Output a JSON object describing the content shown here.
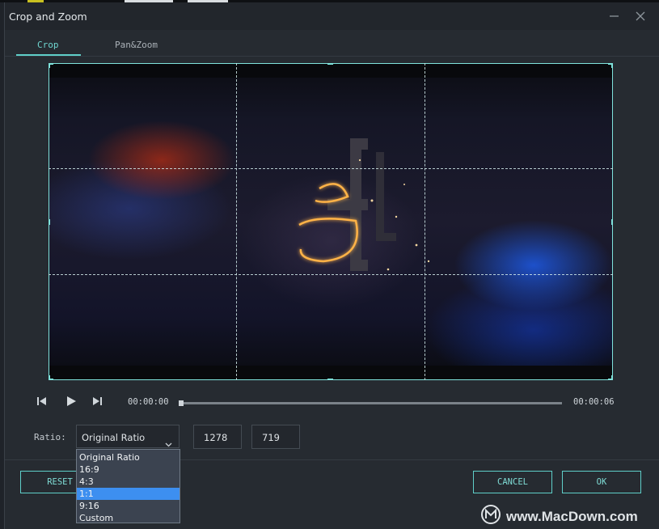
{
  "window": {
    "title": "Crop and Zoom"
  },
  "tabs": [
    {
      "label": "Crop",
      "active": true
    },
    {
      "label": "Pan&Zoom",
      "active": false
    }
  ],
  "player": {
    "current_time": "00:00:00",
    "end_time": "00:00:06",
    "progress": 0
  },
  "settings": {
    "ratio_label": "Ratio:",
    "ratio_value": "Original Ratio",
    "width": "1278",
    "height": "719",
    "ratio_options": [
      "Original Ratio",
      "16:9",
      "4:3",
      "1:1",
      "9:16",
      "Custom"
    ],
    "highlighted_option": "1:1"
  },
  "buttons": {
    "reset": "RESET",
    "cancel": "CANCEL",
    "ok": "OK"
  },
  "watermark": {
    "text": "www.MacDown.com"
  },
  "colors": {
    "accent": "#5fcfc9",
    "selection": "#3d8ff0",
    "background": "#262b31"
  },
  "icons": [
    "minimize-icon",
    "close-icon",
    "previous-frame-icon",
    "play-icon",
    "next-frame-icon",
    "chevron-down-icon",
    "macdown-logo-icon"
  ]
}
